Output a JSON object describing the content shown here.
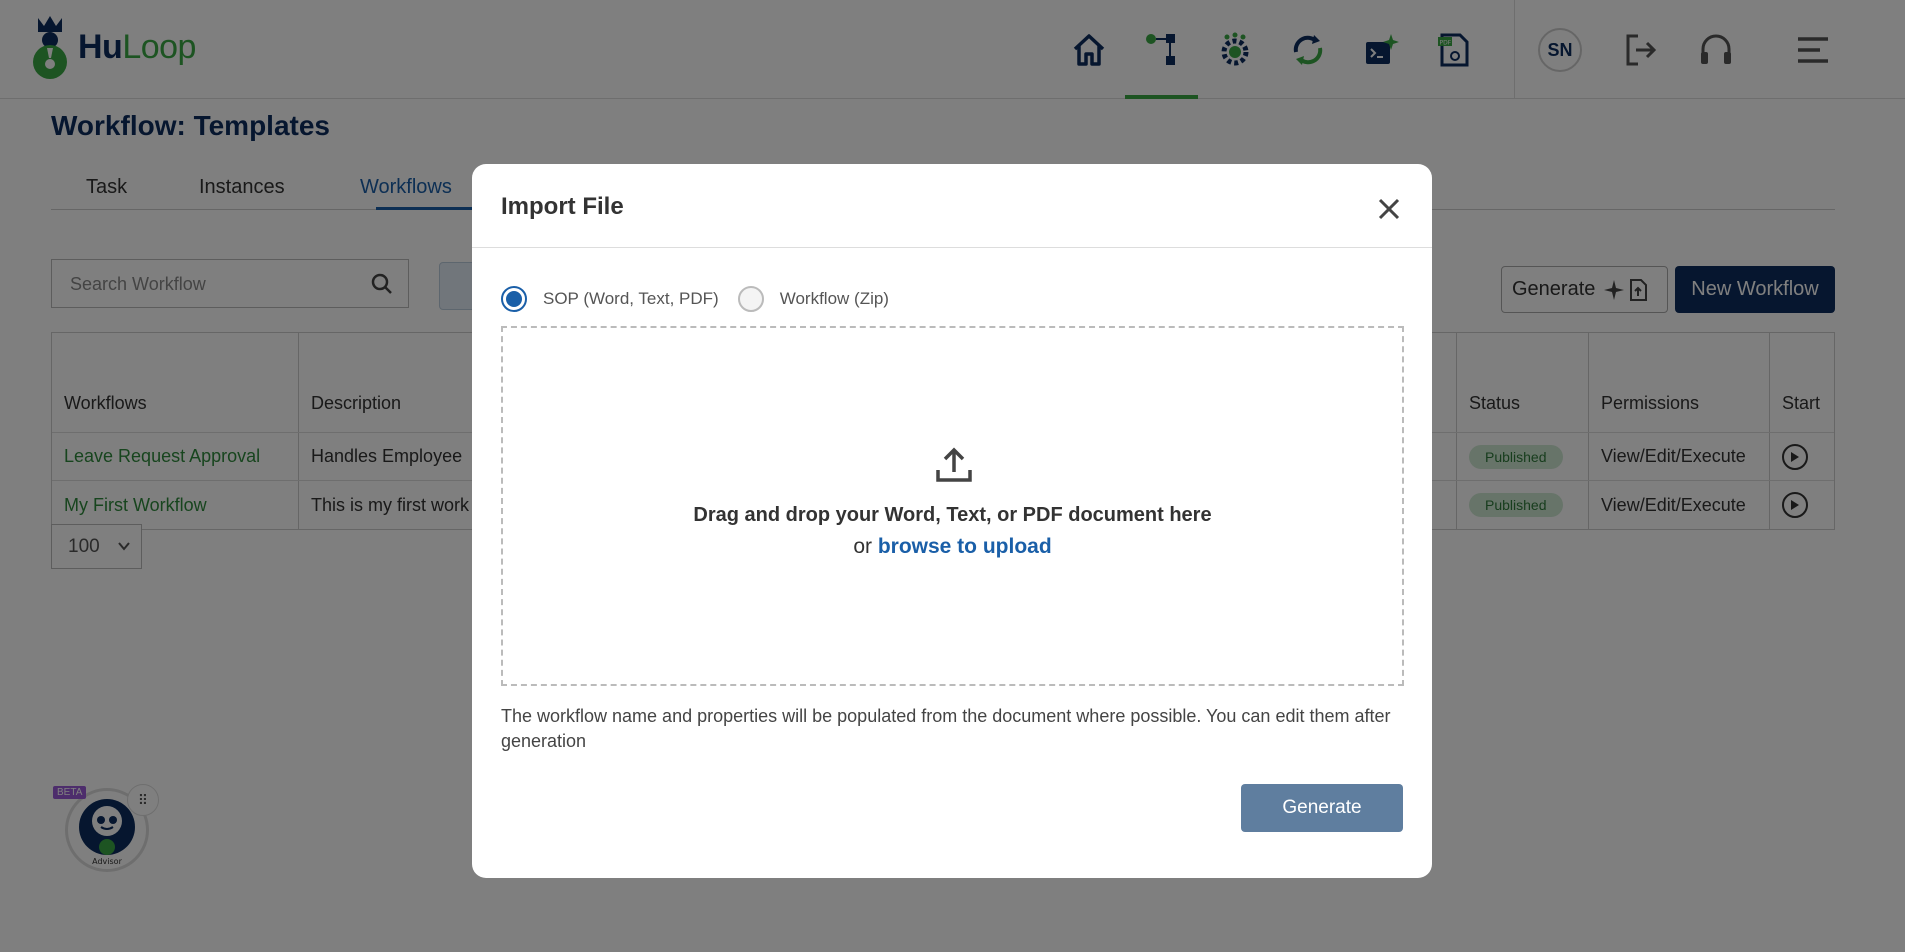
{
  "app": {
    "logo_hu": "Hu",
    "logo_loop": "Loop",
    "colors": {
      "brand_navy": "#0d2d5e",
      "brand_green": "#3aa845",
      "link_blue": "#1a5fa8"
    }
  },
  "nav": {
    "icons": [
      "home-icon",
      "workflow-icon",
      "automation-gear-icon",
      "sync-icon",
      "terminal-spark-icon",
      "pdf-settings-icon"
    ],
    "active_index": 1,
    "avatar_initials": "SN",
    "utility_icons": [
      "logout-icon",
      "headset-icon",
      "hamburger-menu-icon"
    ]
  },
  "page": {
    "title": "Workflow: Templates",
    "tabs": [
      "Task",
      "Instances",
      "Workflows"
    ],
    "active_tab": "Workflows",
    "search_placeholder": "Search Workflow",
    "generate_label": "Generate",
    "new_workflow_label": "New Workflow"
  },
  "table": {
    "headers": {
      "workflows": "Workflows",
      "description": "Description",
      "status": "Status",
      "permissions": "Permissions",
      "start": "Start"
    },
    "rows": [
      {
        "name": "Leave Request Approval",
        "description": "Handles Employee",
        "status": "Published",
        "permissions": "View/Edit/Execute"
      },
      {
        "name": "My First Workflow",
        "description": "This is my first work",
        "status": "Published",
        "permissions": "View/Edit/Execute"
      }
    ],
    "page_size": "100"
  },
  "advisor": {
    "badge": "BETA",
    "label": "Advisor"
  },
  "modal": {
    "title": "Import File",
    "options": [
      {
        "label": "SOP (Word, Text, PDF)",
        "checked": true
      },
      {
        "label": "Workflow (Zip)",
        "checked": false
      }
    ],
    "drop_text": "Drag and drop your Word, Text, or PDF document here",
    "drop_or": "or ",
    "browse_text": "browse to upload",
    "help_text": "The workflow name and properties will be populated from the document where possible. You can edit them after generation",
    "generate_label": "Generate"
  }
}
